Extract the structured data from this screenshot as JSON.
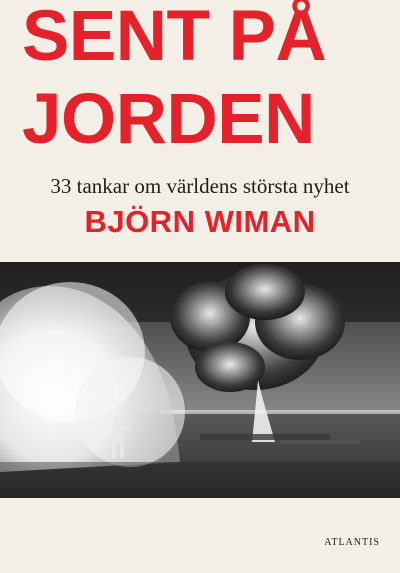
{
  "cover": {
    "title_line1": "SENT PÅ",
    "title_line2": "JORDEN",
    "subtitle": "33 tankar om världens största nyhet",
    "author": "BJÖRN WIMAN",
    "publisher": "ATLANTIS"
  },
  "colors": {
    "background": "#f3efe6",
    "accent_red": "#e3222b",
    "text_dark": "#1d1d1d"
  }
}
